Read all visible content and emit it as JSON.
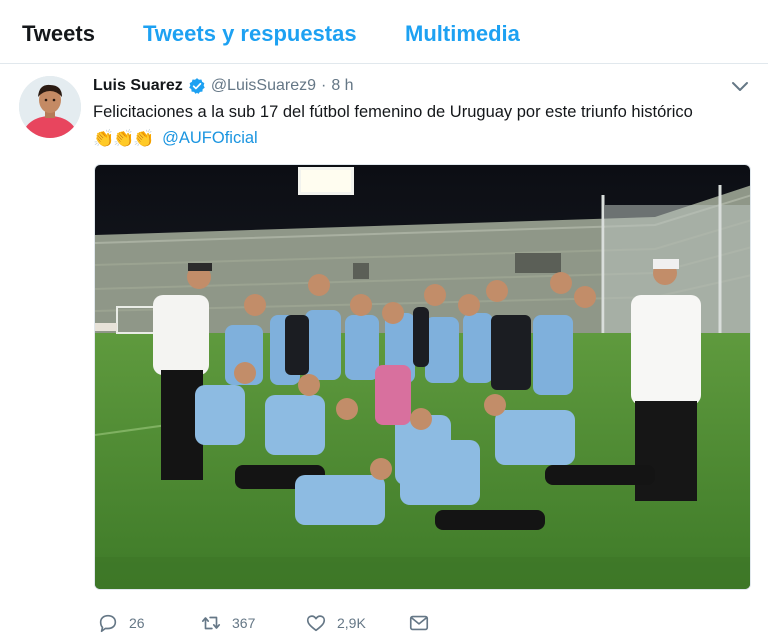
{
  "tabs": [
    {
      "label": "Tweets"
    },
    {
      "label": "Tweets y respuestas"
    },
    {
      "label": "Multimedia"
    }
  ],
  "tweet": {
    "author_name": "Luis Suarez",
    "handle": "@LuisSuarez9",
    "separator": "·",
    "time": "8 h",
    "text": "Felicitaciones a la sub 17 del fútbol femenino de Uruguay por este triunfo histórico",
    "emojis": "👏👏👏",
    "mention": "@AUFOficial",
    "icons": {
      "avatar": "avatar",
      "verified": "verified-badge-icon",
      "menu": "chevron-down-icon",
      "photo": "team-photo"
    },
    "colors": {
      "accent": "#1da1f2",
      "link": "#1b95e0",
      "muted": "#657786",
      "verified": "#1da1f2",
      "pitch": "#4f8a34",
      "jersey": "#7fb0dc"
    }
  },
  "actions": {
    "replies": "26",
    "retweets": "367",
    "likes": "2,9K"
  }
}
